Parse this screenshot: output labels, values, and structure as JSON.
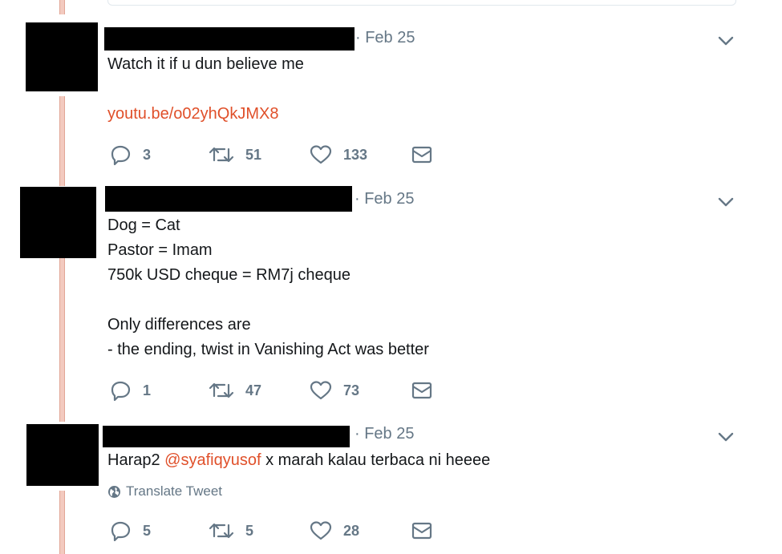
{
  "tweets": [
    {
      "date": "· Feb 25",
      "text": "Watch it if u dun believe me",
      "link": "youtu.be/o02yhQkJMX8",
      "replies": "3",
      "retweets": "51",
      "likes": "133"
    },
    {
      "date": "· Feb 25",
      "text": "Dog = Cat\nPastor = Imam\n750k USD cheque = RM7j cheque\n\nOnly differences are\n- the ending, twist in Vanishing Act was better",
      "replies": "1",
      "retweets": "47",
      "likes": "73"
    },
    {
      "date": "· Feb 25",
      "text_before": "Harap2 ",
      "mention": "@syafiqyusof",
      "text_after": " x marah kalau terbaca ni heeee",
      "translate_label": "Translate Tweet",
      "replies": "5",
      "retweets": "5",
      "likes": "28"
    }
  ],
  "icons": {
    "reply": "reply-icon",
    "retweet": "retweet-icon",
    "like": "heart-icon",
    "message": "envelope-icon",
    "caret": "chevron-down-icon",
    "globe": "globe-icon"
  },
  "colors": {
    "link": "#e0502a",
    "muted": "#657786",
    "text": "#14171a",
    "thread_line": "#f3cabf"
  }
}
